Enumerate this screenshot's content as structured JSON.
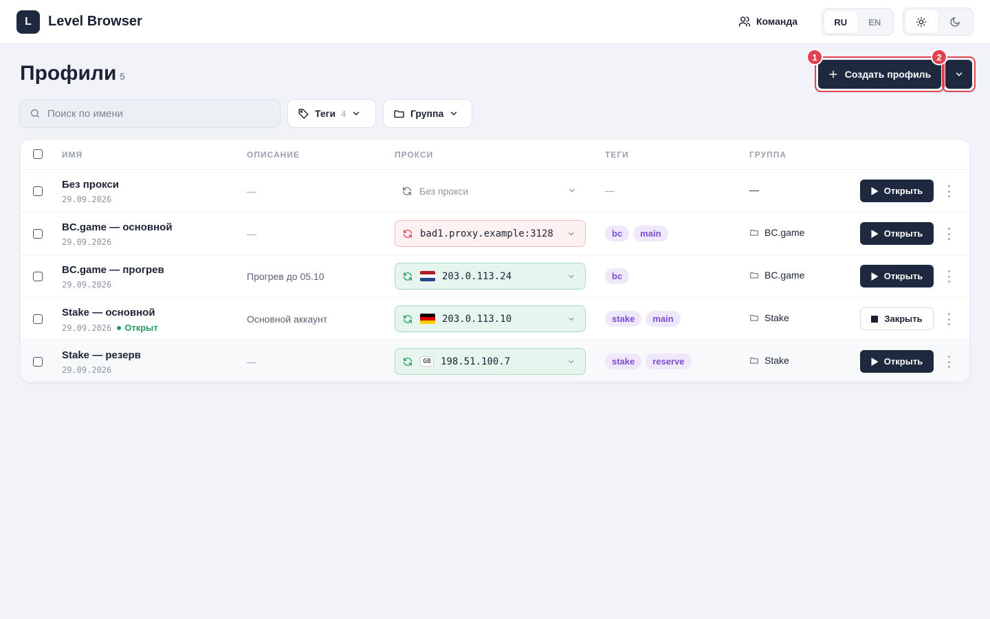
{
  "header": {
    "logo_letter": "L",
    "app_title": "Level Browser",
    "team_label": "Команда",
    "languages": [
      "RU",
      "EN"
    ],
    "active_language": "RU",
    "themes": [
      "sun-icon",
      "moon-icon"
    ],
    "active_theme": "light"
  },
  "page": {
    "title": "Профили",
    "count": "5",
    "create_label": "Создать профиль",
    "annotations": [
      "1",
      "2"
    ]
  },
  "filters": {
    "search_placeholder": "Поиск по имени",
    "search_value": "",
    "tags_label": "Теги",
    "tags_count": "4",
    "group_label": "Группа"
  },
  "table": {
    "columns": [
      "ИМЯ",
      "ОПИСАНИЕ",
      "ПРОКСИ",
      "ТЕГИ",
      "ГРУППА"
    ],
    "rows": [
      {
        "name": "Без прокси",
        "date": "29.09.2026",
        "status": "",
        "description": "—",
        "proxy": "Без прокси",
        "proxy_state": "none",
        "country": "",
        "tags": [],
        "tags_empty": "—",
        "group": "—",
        "action": "Открыть"
      },
      {
        "name": "BC.game — основной",
        "date": "29.09.2026",
        "status": "",
        "description": "—",
        "proxy": "bad1.proxy.example:3128",
        "proxy_state": "bad",
        "country": "",
        "tags": [
          "bc",
          "main"
        ],
        "group": "BC.game",
        "action": "Открыть"
      },
      {
        "name": "BC.game — прогрев",
        "date": "29.09.2026",
        "status": "",
        "description": "Прогрев до 05.10",
        "proxy": "203.0.113.24",
        "proxy_state": "ok",
        "country": "NL",
        "tags": [
          "bc"
        ],
        "group": "BC.game",
        "action": "Открыть"
      },
      {
        "name": "Stake — основной",
        "date": "29.09.2026",
        "status": "Открыт",
        "description": "Основной аккаунт",
        "proxy": "203.0.113.10",
        "proxy_state": "ok",
        "country": "DE",
        "tags": [
          "stake",
          "main"
        ],
        "group": "Stake",
        "action": "Закрыть"
      },
      {
        "name": "Stake — резерв",
        "date": "29.09.2026",
        "status": "",
        "description": "—",
        "proxy": "198.51.100.7",
        "proxy_state": "ok",
        "country": "GB",
        "tags": [
          "stake",
          "reserve"
        ],
        "group": "Stake",
        "action": "Открыть"
      }
    ]
  },
  "colors": {
    "primary": "#1e2940",
    "accent_red": "#e0424f",
    "ok_green": "#1f9d61",
    "tag_purple": "#7a4fd0"
  }
}
